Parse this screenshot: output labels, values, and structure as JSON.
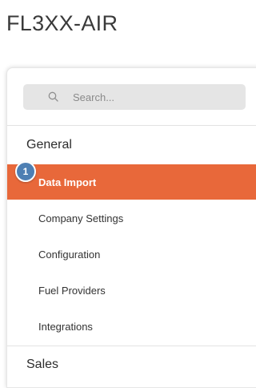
{
  "app": {
    "title": "FL3XX-AIR"
  },
  "search": {
    "placeholder": "Search..."
  },
  "sections": [
    {
      "title": "General",
      "items": [
        {
          "label": "Data Import",
          "active": true
        },
        {
          "label": "Company Settings"
        },
        {
          "label": "Configuration"
        },
        {
          "label": "Fuel Providers"
        },
        {
          "label": "Integrations"
        }
      ]
    },
    {
      "title": "Sales"
    }
  ],
  "step_badge": {
    "number": "1"
  },
  "colors": {
    "accent": "#e8683a",
    "badge": "#4e7fb3",
    "search_bg": "#e5e5e5"
  },
  "icons": {
    "search": "search-icon"
  }
}
